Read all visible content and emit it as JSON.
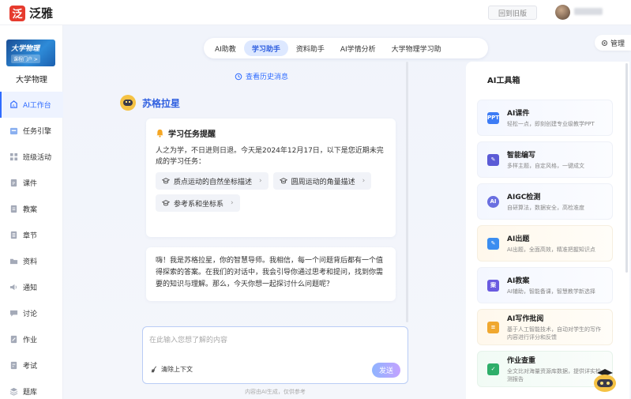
{
  "header": {
    "logo_text": "泛雅",
    "old_version_label": "回到旧版"
  },
  "course": {
    "cover_title": "大学物理",
    "cover_sub": "课程门户 >",
    "name": "大学物理"
  },
  "sidebar": {
    "items": [
      {
        "label": "AI工作台",
        "icon": "robot-icon"
      },
      {
        "label": "任务引擎",
        "icon": "calendar-icon"
      },
      {
        "label": "班级活动",
        "icon": "grid-icon"
      },
      {
        "label": "课件",
        "icon": "slides-icon"
      },
      {
        "label": "教案",
        "icon": "doc-icon"
      },
      {
        "label": "章节",
        "icon": "list-icon"
      },
      {
        "label": "资料",
        "icon": "folder-icon"
      },
      {
        "label": "通知",
        "icon": "speaker-icon"
      },
      {
        "label": "讨论",
        "icon": "chat-icon"
      },
      {
        "label": "作业",
        "icon": "pencil-icon"
      },
      {
        "label": "考试",
        "icon": "exam-icon"
      },
      {
        "label": "题库",
        "icon": "stack-icon"
      }
    ]
  },
  "tabs": [
    {
      "label": "AI助教"
    },
    {
      "label": "学习助手"
    },
    {
      "label": "资料助手"
    },
    {
      "label": "AI学情分析"
    },
    {
      "label": "大学物理学习助"
    }
  ],
  "manage_label": "管理",
  "chat": {
    "history_link": "查看历史消息",
    "bot_name": "苏格拉星",
    "task_title": "学习任务提醒",
    "task_desc": "人之为学，不日进则日退。今天是2024年12月17日，以下是您近期未完成的学习任务：",
    "tasks": [
      {
        "label": "质点运动的自然坐标描述"
      },
      {
        "label": "圆周运动的角量描述"
      },
      {
        "label": "参考系和坐标系"
      }
    ],
    "intro": "嗨！我是苏格拉星，你的智慧导师。我相信，每一个问题背后都有一个值得探索的答案。在我们的对话中，我会引导你通过思考和提问，找到你需要的知识与理解。那么，今天你想一起探讨什么问题呢？",
    "input_placeholder": "在此输入您想了解的内容",
    "clear_context": "清除上下文",
    "send_label": "发送",
    "disclaimer": "内容由AI生成，仅供参考"
  },
  "toolbox": {
    "title": "AI工具箱",
    "tools": [
      {
        "name": "AI课件",
        "desc": "轻松一点，即刻创建专业级教学PPT",
        "icon": "ppt-icon",
        "color": "#3d7cf5"
      },
      {
        "name": "智能编写",
        "desc": "多样主题，自定风格，一键成文",
        "icon": "write-icon",
        "color": "#5b5bd6"
      },
      {
        "name": "AIGC检测",
        "desc": "自研算法，数据安全，高检准度",
        "icon": "detect-icon",
        "color": "#6a6fe0"
      },
      {
        "name": "AI出题",
        "desc": "AI出题，全面高效，精准把握知识点",
        "icon": "question-icon",
        "color": "#3b8df0"
      },
      {
        "name": "AI教案",
        "desc": "AI辅助，智能备课，智慧教学新选择",
        "icon": "plan-icon",
        "color": "#6a5be0"
      },
      {
        "name": "AI写作批阅",
        "desc": "基于人工智能技术，自动对学生的写作内容进行评分和反馈",
        "icon": "review-icon",
        "color": "#f0a830"
      },
      {
        "name": "作业查重",
        "desc": "全文比对海量资源库数据，提供详实检测报告",
        "icon": "check-icon",
        "color": "#2fae6a"
      }
    ]
  }
}
